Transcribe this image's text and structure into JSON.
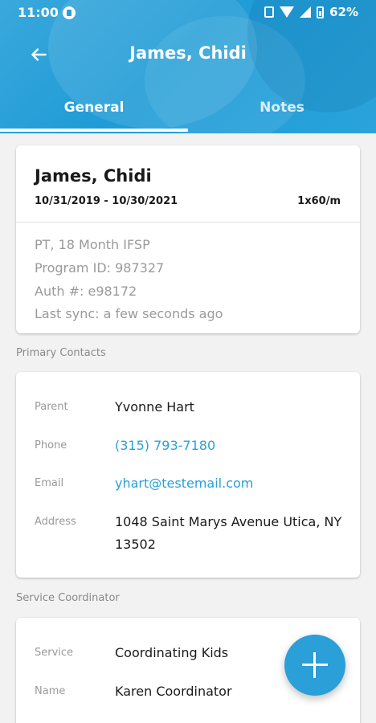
{
  "status_bar": {
    "time": "11:00",
    "battery": "62%",
    "icons": [
      "app-notification-icon",
      "vibrate-icon",
      "wifi-icon",
      "signal-icon",
      "battery-icon"
    ]
  },
  "header": {
    "title": "James, Chidi",
    "back_icon": "arrow-left-icon",
    "accent_color": "#2a9fd8"
  },
  "tabs": [
    {
      "label": "General",
      "selected": true
    },
    {
      "label": "Notes",
      "selected": false
    }
  ],
  "client_card": {
    "name": "James, Chidi",
    "date_range": "10/31/2019 - 10/30/2021",
    "frequency": "1x60/m",
    "details": [
      "PT, 18 Month IFSP",
      "Program ID: 987327",
      "Auth #: e98172",
      "Last sync: a few seconds ago"
    ]
  },
  "primary_contacts": {
    "section_label": "Primary Contacts",
    "rows": [
      {
        "label": "Parent",
        "value": "Yvonne Hart"
      },
      {
        "label": "Phone",
        "value": "(315) 793-7180"
      },
      {
        "label": "Email",
        "value": "yhart@testemail.com"
      },
      {
        "label": "Address",
        "value": "1048  Saint Marys Avenue Utica, NY  13502"
      }
    ]
  },
  "service_coordinator": {
    "section_label": "Service Coordinator",
    "rows": [
      {
        "label": "Service",
        "value": "Coordinating Kids"
      },
      {
        "label": "Name",
        "value": "Karen Coordinator"
      }
    ]
  },
  "fab": {
    "icon": "plus-icon"
  }
}
